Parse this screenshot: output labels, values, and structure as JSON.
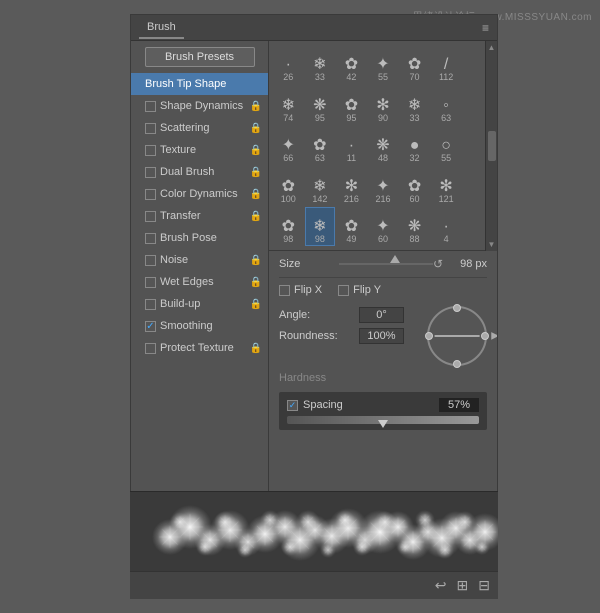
{
  "watermark": {
    "text1": "思绪设计论坛",
    "text2": "www.MISSSYUAN.com"
  },
  "panel": {
    "tab": "Brush",
    "menu_icon": "≡"
  },
  "sidebar": {
    "preset_button": "Brush Presets",
    "items": [
      {
        "label": "Brush Tip Shape",
        "active": true,
        "has_checkbox": false,
        "has_lock": false
      },
      {
        "label": "Shape Dynamics",
        "active": false,
        "has_checkbox": true,
        "has_lock": true,
        "checked": false
      },
      {
        "label": "Scattering",
        "active": false,
        "has_checkbox": true,
        "has_lock": true,
        "checked": false
      },
      {
        "label": "Texture",
        "active": false,
        "has_checkbox": true,
        "has_lock": true,
        "checked": false
      },
      {
        "label": "Dual Brush",
        "active": false,
        "has_checkbox": true,
        "has_lock": true,
        "checked": false
      },
      {
        "label": "Color Dynamics",
        "active": false,
        "has_checkbox": true,
        "has_lock": true,
        "checked": false
      },
      {
        "label": "Transfer",
        "active": false,
        "has_checkbox": true,
        "has_lock": true,
        "checked": false
      },
      {
        "label": "Brush Pose",
        "active": false,
        "has_checkbox": true,
        "has_lock": false,
        "checked": false
      },
      {
        "label": "Noise",
        "active": false,
        "has_checkbox": true,
        "has_lock": true,
        "checked": false
      },
      {
        "label": "Wet Edges",
        "active": false,
        "has_checkbox": true,
        "has_lock": true,
        "checked": false
      },
      {
        "label": "Build-up",
        "active": false,
        "has_checkbox": true,
        "has_lock": true,
        "checked": false
      },
      {
        "label": "Smoothing",
        "active": false,
        "has_checkbox": true,
        "has_lock": false,
        "checked": true
      },
      {
        "label": "Protect Texture",
        "active": false,
        "has_checkbox": true,
        "has_lock": true,
        "checked": false
      }
    ]
  },
  "brush_grid": {
    "cells": [
      {
        "size": 26,
        "icon": "·",
        "selected": false
      },
      {
        "size": 33,
        "icon": "❄",
        "selected": false
      },
      {
        "size": 42,
        "icon": "✿",
        "selected": false
      },
      {
        "size": 55,
        "icon": "✦",
        "selected": false
      },
      {
        "size": 70,
        "icon": "✿",
        "selected": false
      },
      {
        "size": 112,
        "icon": "/",
        "selected": false
      },
      {
        "size": "",
        "icon": "",
        "selected": false
      },
      {
        "size": 74,
        "icon": "❄",
        "selected": false
      },
      {
        "size": 95,
        "icon": "❋",
        "selected": false
      },
      {
        "size": 95,
        "icon": "✿",
        "selected": false
      },
      {
        "size": 90,
        "icon": "✻",
        "selected": false
      },
      {
        "size": 33,
        "icon": "❄",
        "selected": false
      },
      {
        "size": 63,
        "icon": "◦",
        "selected": false
      },
      {
        "size": "",
        "icon": "",
        "selected": false
      },
      {
        "size": 66,
        "icon": "✦",
        "selected": false
      },
      {
        "size": 63,
        "icon": "✿",
        "selected": false
      },
      {
        "size": 11,
        "icon": "·",
        "selected": false
      },
      {
        "size": 48,
        "icon": "❋",
        "selected": false
      },
      {
        "size": 32,
        "icon": "●",
        "selected": false
      },
      {
        "size": 55,
        "icon": "○",
        "selected": false
      },
      {
        "size": "",
        "icon": "",
        "selected": false
      },
      {
        "size": 100,
        "icon": "✿",
        "selected": false
      },
      {
        "size": 142,
        "icon": "❄",
        "selected": false
      },
      {
        "size": 216,
        "icon": "✻",
        "selected": false
      },
      {
        "size": 216,
        "icon": "✦",
        "selected": false
      },
      {
        "size": 60,
        "icon": "✿",
        "selected": false
      },
      {
        "size": 121,
        "icon": "✻",
        "selected": false
      },
      {
        "size": "",
        "icon": "",
        "selected": false
      },
      {
        "size": 98,
        "icon": "✿",
        "selected": false
      },
      {
        "size": 98,
        "icon": "❄",
        "selected": true
      },
      {
        "size": 49,
        "icon": "✿",
        "selected": false
      },
      {
        "size": 60,
        "icon": "✦",
        "selected": false
      },
      {
        "size": 88,
        "icon": "❋",
        "selected": false
      },
      {
        "size": 4,
        "icon": "·",
        "selected": false
      },
      {
        "size": "",
        "icon": "",
        "selected": false
      }
    ]
  },
  "controls": {
    "size_label": "Size",
    "size_value": "98 px",
    "flip_x_label": "Flip X",
    "flip_y_label": "Flip Y",
    "angle_label": "Angle:",
    "angle_value": "0°",
    "roundness_label": "Roundness:",
    "roundness_value": "100%",
    "hardness_label": "Hardness",
    "spacing_label": "Spacing",
    "spacing_value": "57%",
    "spacing_checked": true
  },
  "preview": {
    "description": "brush stroke preview"
  },
  "bottom_bar": {
    "icons": [
      "↩",
      "⊞",
      "⊟"
    ]
  }
}
